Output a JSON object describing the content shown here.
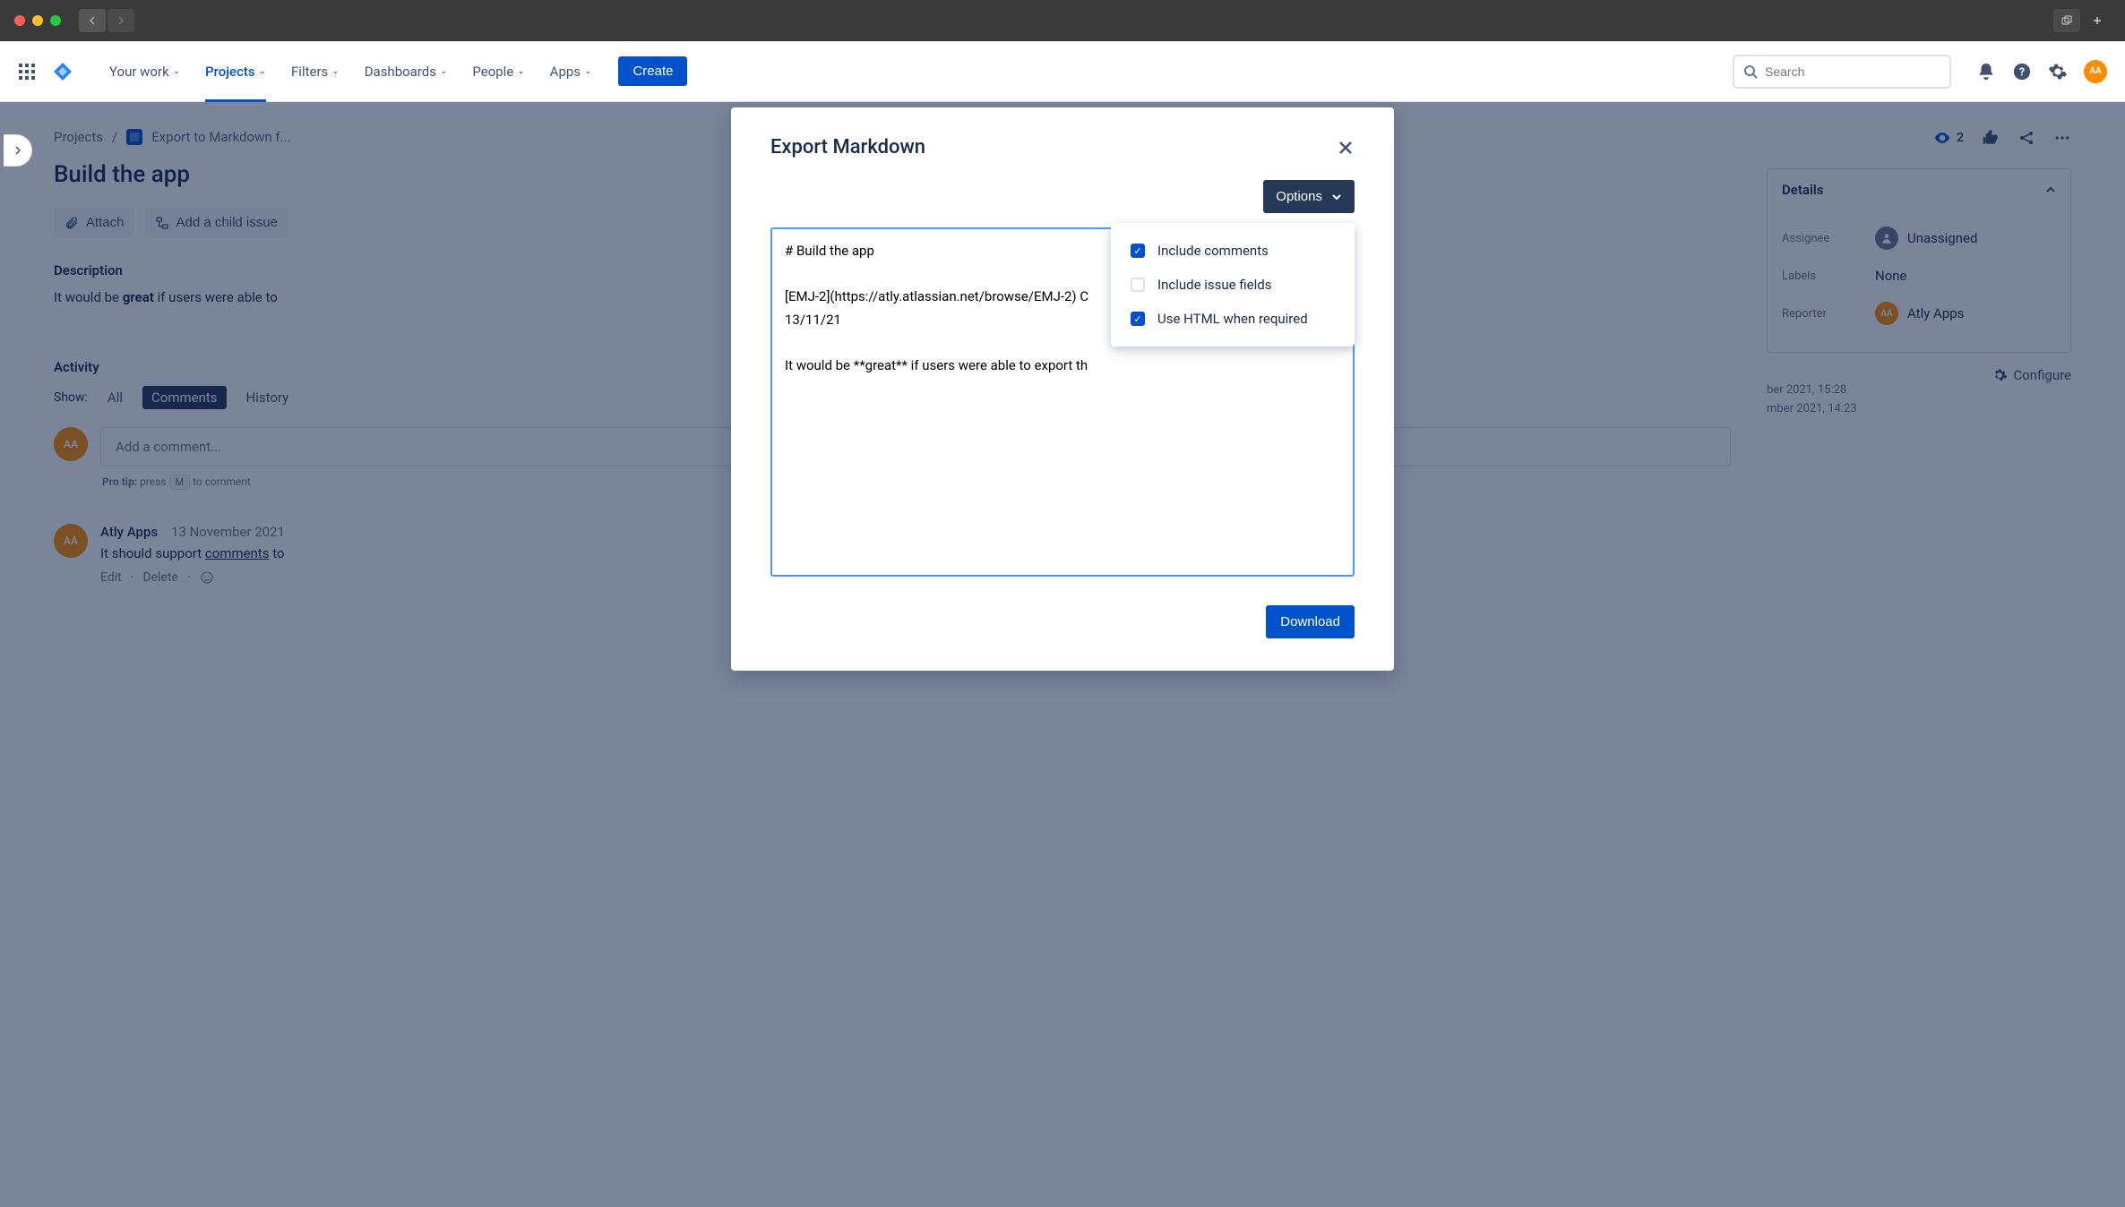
{
  "nav": {
    "items": [
      "Your work",
      "Projects",
      "Filters",
      "Dashboards",
      "People",
      "Apps"
    ],
    "active_index": 1,
    "create": "Create",
    "search_placeholder": "Search"
  },
  "breadcrumb": {
    "root": "Projects",
    "project": "Export to Markdown f..."
  },
  "issue": {
    "title": "Build the app",
    "attach": "Attach",
    "add_child": "Add a child issue",
    "description_label": "Description",
    "description_html": "It would be <b>great</b> if users were able to",
    "activity_label": "Activity",
    "show_label": "Show:",
    "tabs": [
      "All",
      "Comments",
      "History"
    ],
    "active_tab": 1,
    "comment_placeholder": "Add a comment...",
    "protip_prefix": "Pro tip:",
    "protip_press": "press",
    "protip_key": "M",
    "protip_suffix": "to comment",
    "comment": {
      "author": "Atly Apps",
      "date": "13 November 2021",
      "body_prefix": "It should support ",
      "body_link": "comments",
      "body_suffix": " to",
      "edit": "Edit",
      "delete": "Delete"
    }
  },
  "side": {
    "watch_count": "2",
    "details_label": "Details",
    "assignee_label": "Assignee",
    "assignee_value": "Unassigned",
    "labels_label": "Labels",
    "labels_value": "None",
    "reporter_label": "Reporter",
    "reporter_value": "Atly Apps",
    "created_line": "ber 2021, 15:28",
    "updated_line": "mber 2021, 14:23",
    "configure": "Configure"
  },
  "modal": {
    "title": "Export Markdown",
    "options_btn": "Options",
    "opt_comments": "Include comments",
    "opt_fields": "Include issue fields",
    "opt_html": "Use HTML when required",
    "textarea": "# Build the app\n\n[EMJ-2](https://atly.atlassian.net/browse/EMJ-2) C\n13/11/21\n\nIt would be **great** if users were able to export th",
    "download": "Download"
  },
  "avatar_initials": "AA"
}
